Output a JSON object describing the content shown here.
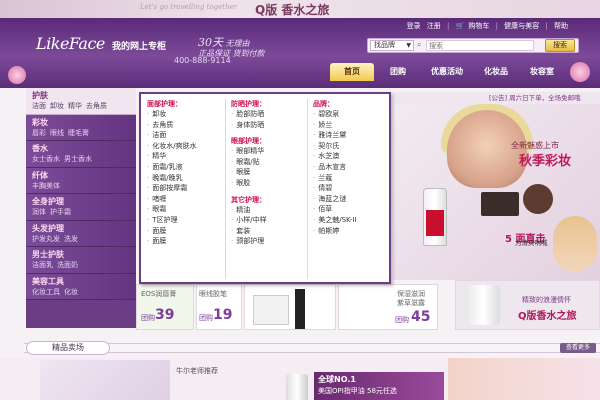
{
  "promo": {
    "script": "Let's go travelling together",
    "title": "Q版 香水之旅"
  },
  "header": {
    "logo_en": "LikeFace",
    "logo_cn": "我的网上专柜",
    "phone": "400-888-9114",
    "slogan_big": "30天",
    "slogan_line1": "无理由",
    "slogan_line2": "正品保证 货到付款"
  },
  "toplinks": {
    "login": "登录",
    "register": "注册",
    "cart": "购物车",
    "beauty": "健康与美容",
    "more": "帮助"
  },
  "search": {
    "category": "找品牌",
    "placeholder": "搜索",
    "button": "搜索"
  },
  "nav": [
    "首页",
    "团购",
    "优惠活动",
    "化妆品",
    "妆容室"
  ],
  "categories": [
    {
      "title": "护肤",
      "subs": [
        "洁面",
        "卸妆",
        "精华",
        "去角质"
      ]
    },
    {
      "title": "彩妆",
      "subs": [
        "唇彩",
        "眼线",
        "睫毛膏"
      ]
    },
    {
      "title": "香水",
      "subs": [
        "女士香水",
        "男士香水"
      ]
    },
    {
      "title": "纤体",
      "subs": [
        "丰胸美体"
      ]
    },
    {
      "title": "全身护理",
      "subs": [
        "润体",
        "护手霜"
      ]
    },
    {
      "title": "头发护理",
      "subs": [
        "护发丸发",
        "洗发"
      ]
    },
    {
      "title": "男士护肤",
      "subs": [
        "洁面乳",
        "洗面奶"
      ]
    },
    {
      "title": "美容工具",
      "subs": [
        "化妆工具",
        "化妆"
      ]
    }
  ],
  "dropdown": {
    "col1": {
      "title": "面部护理：",
      "items": [
        "卸妆",
        "去角质",
        "洁面",
        "化妆水/爽肤水",
        "精华",
        "面霜/乳液",
        "晚霜/晚乳",
        "面部按摩霜",
        "啫喱",
        "眼霜",
        "T区护理",
        "面膜",
        "面膜"
      ]
    },
    "col2a": {
      "title": "防晒护理：",
      "items": [
        "脸部防晒",
        "身体防晒"
      ]
    },
    "col2b": {
      "title": "眼部护理：",
      "items": [
        "眼部精华",
        "眼霜/贴",
        "眼膜",
        "眼胶"
      ]
    },
    "col2c": {
      "title": "其它护理：",
      "items": [
        "精油",
        "小样/中样",
        "套装",
        "颈部护理"
      ]
    },
    "col3": {
      "title": "品牌：",
      "items": [
        "碧欧泉",
        "娇兰",
        "雅诗兰黛",
        "契尔氏",
        "水芝澳",
        "品木宣言",
        "兰蔻",
        "倩碧",
        "海蓝之谜",
        "佰草",
        "美之魅/SK-II",
        "帕斯婷"
      ]
    }
  },
  "notice": "[公告] 周六日下单，全场免邮哦",
  "banner": {
    "line1": "全新魅惑上市",
    "line2": "秋季彩妆",
    "q_big": "5 面直击",
    "q_small": "为清爽呐喊"
  },
  "tiles": {
    "t1_name": "EOS润唇膏",
    "t1_tag": "团购",
    "t1_price": "39",
    "t2_name": "眼线胶笔",
    "t2_tag": "团购",
    "t2_price": "19",
    "t3_name": "",
    "t4_name": "保湿滋润",
    "t4_sub": "紫草滋露",
    "t4_tag": "团购",
    "t4_price": "45",
    "t6_l1": "精致的浪漫情怀",
    "t6_l2": "Q版香水之旅"
  },
  "section": {
    "title": "精品卖场",
    "more": "查看更多"
  },
  "bottom": {
    "note": "牛尔老师推荐",
    "ad1": "全球NO.1",
    "ad2": "美国OPI指甲油  58元任选"
  }
}
